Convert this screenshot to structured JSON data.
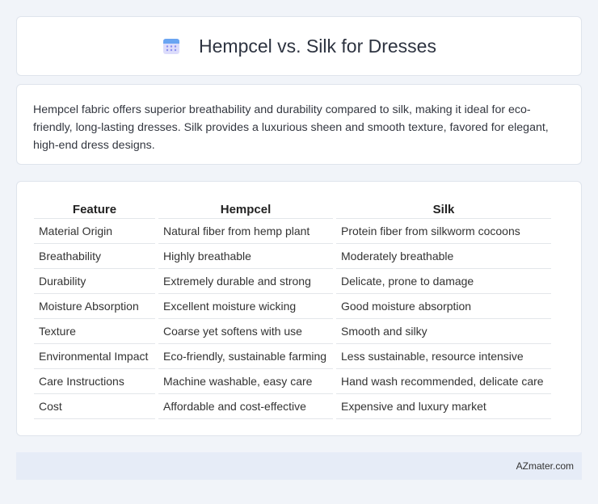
{
  "header": {
    "title": "Hempcel vs. Silk for Dresses",
    "icon": "calendar-icon"
  },
  "summary": {
    "text": "Hempcel fabric offers superior breathability and durability compared to silk, making it ideal for eco-friendly, long-lasting dresses. Silk provides a luxurious sheen and smooth texture, favored for elegant, high-end dress designs."
  },
  "table": {
    "headers": [
      "Feature",
      "Hempcel",
      "Silk"
    ],
    "rows": [
      [
        "Material Origin",
        "Natural fiber from hemp plant",
        "Protein fiber from silkworm cocoons"
      ],
      [
        "Breathability",
        "Highly breathable",
        "Moderately breathable"
      ],
      [
        "Durability",
        "Extremely durable and strong",
        "Delicate, prone to damage"
      ],
      [
        "Moisture Absorption",
        "Excellent moisture wicking",
        "Good moisture absorption"
      ],
      [
        "Texture",
        "Coarse yet softens with use",
        "Smooth and silky"
      ],
      [
        "Environmental Impact",
        "Eco-friendly, sustainable farming",
        "Less sustainable, resource intensive"
      ],
      [
        "Care Instructions",
        "Machine washable, easy care",
        "Hand wash recommended, delicate care"
      ],
      [
        "Cost",
        "Affordable and cost-effective",
        "Expensive and luxury market"
      ]
    ]
  },
  "footer": {
    "text": "AZmater.com"
  },
  "colors": {
    "background": "#f1f4f9",
    "card": "#ffffff",
    "footer": "#e6ecf7",
    "icon_accent": "#8b8ff0"
  }
}
